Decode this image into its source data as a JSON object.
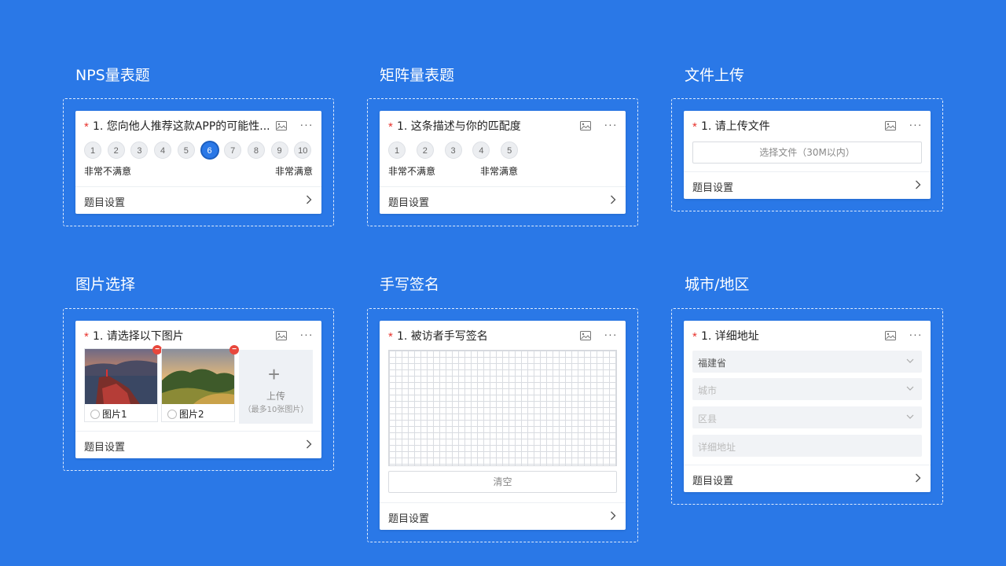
{
  "sections": {
    "nps": {
      "title": "NPS量表题",
      "question": "1. 您向他人推荐这款APP的可能性...",
      "options": [
        "1",
        "2",
        "3",
        "4",
        "5",
        "6",
        "7",
        "8",
        "9",
        "10"
      ],
      "selected": "6",
      "low_label": "非常不满意",
      "high_label": "非常满意",
      "footer": "题目设置"
    },
    "matrix": {
      "title": "矩阵量表题",
      "question": "1. 这条描述与你的匹配度",
      "options": [
        "1",
        "2",
        "3",
        "4",
        "5"
      ],
      "low_label": "非常不满意",
      "high_label": "非常满意",
      "footer": "题目设置"
    },
    "upload": {
      "title": "文件上传",
      "question": "1. 请上传文件",
      "button": "选择文件（30M以内）",
      "footer": "题目设置"
    },
    "image_choice": {
      "title": "图片选择",
      "question": "1. 请选择以下图片",
      "images": [
        {
          "label": "图片1"
        },
        {
          "label": "图片2"
        }
      ],
      "delete_glyph": "−",
      "upload_plus": "+",
      "upload_label": "上传",
      "upload_hint": "（最多10张图片）",
      "footer": "题目设置"
    },
    "signature": {
      "title": "手写签名",
      "question": "1. 被访者手写签名",
      "clear_button": "清空",
      "footer": "题目设置"
    },
    "city": {
      "title": "城市/地区",
      "question": "1. 详细地址",
      "fields": [
        {
          "value": "福建省",
          "filled": true,
          "has_dropdown": true
        },
        {
          "value": "城市",
          "filled": false,
          "has_dropdown": true
        },
        {
          "value": "区县",
          "filled": false,
          "has_dropdown": true
        },
        {
          "value": "详细地址",
          "filled": false,
          "has_dropdown": false
        }
      ],
      "footer": "题目设置"
    }
  },
  "required_mark": "*",
  "more_glyph": "···",
  "colors": {
    "background": "#2a78e7",
    "accent": "#2a78e7",
    "required": "#e8342e",
    "delete_badge": "#e8473c"
  }
}
